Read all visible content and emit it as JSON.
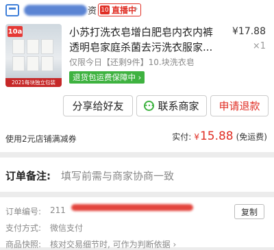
{
  "shop": {
    "suffix": "资",
    "live_icon": "10",
    "live_label": "直播中",
    "arrow": "›"
  },
  "product": {
    "thumb_tag": "10a",
    "thumb_banner": "2021每块独立包装",
    "title": "小苏打洗衣皂增白肥皂内衣内裤透明皂家庭杀菌去污洗衣服家...",
    "price": "¥17.88",
    "quantity": "×1",
    "spec": "仅限今日【还剩9件】10.块洗衣皂",
    "guarantee": "退货包运费保障中 ›"
  },
  "actions": {
    "share": "分享给好友",
    "contact": "联系商家",
    "refund": "申请退款"
  },
  "payment": {
    "coupon": "使用2元店铺满减券",
    "paid_label": "实付:",
    "currency": "¥",
    "amount": "15.88",
    "note": "(免运费)"
  },
  "remark": {
    "label": "订单备注:",
    "placeholder": "填写前需与商家协商一致"
  },
  "order": {
    "number_label": "订单编号:",
    "number_prefix": "211",
    "copy": "复制",
    "pay_method_label": "支付方式:",
    "pay_method": "微信支付",
    "snapshot_label": "商品快照:",
    "snapshot": "核对交易细节时, 可作为判断依据 ›"
  }
}
